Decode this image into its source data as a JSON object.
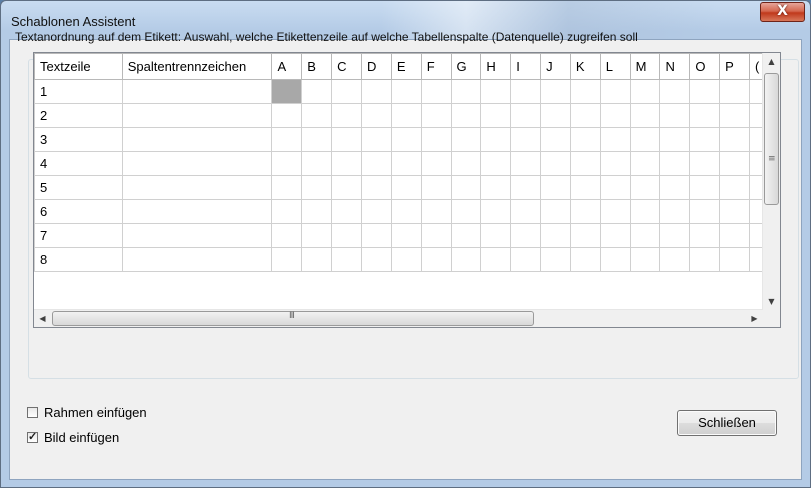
{
  "window": {
    "title": "Schablonen Assistent",
    "close_glyph": "X"
  },
  "caption": "Textanordnung auf dem Etikett: Auswahl, welche Etikettenzeile auf welche Tabellenspalte (Datenquelle) zugreifen soll",
  "grid": {
    "col_textzeile": "Textzeile",
    "col_separator": "Spaltentrennzeichen",
    "letter_columns": [
      "A",
      "B",
      "C",
      "D",
      "E",
      "F",
      "G",
      "H",
      "I",
      "J",
      "K",
      "L",
      "M",
      "N",
      "O",
      "P",
      "("
    ],
    "rows": [
      "1",
      "2",
      "3",
      "4",
      "5",
      "6",
      "7",
      "8"
    ],
    "selected_cell": {
      "row": "1",
      "column": "A"
    }
  },
  "scrollbars": {
    "up_icon": "up-arrow-icon",
    "down_icon": "down-arrow-icon",
    "left_icon": "left-arrow-icon",
    "right_icon": "right-arrow-icon"
  },
  "options": {
    "frame_label": "Rahmen einfügen",
    "frame_checked": false,
    "image_label": "Bild einfügen",
    "image_checked": true
  },
  "close_button_label": "Schließen",
  "colors": {
    "close_button_red": "#c0391c",
    "selected_cell": "#a8a8a8",
    "dialog_background": "#f0f0f0"
  }
}
